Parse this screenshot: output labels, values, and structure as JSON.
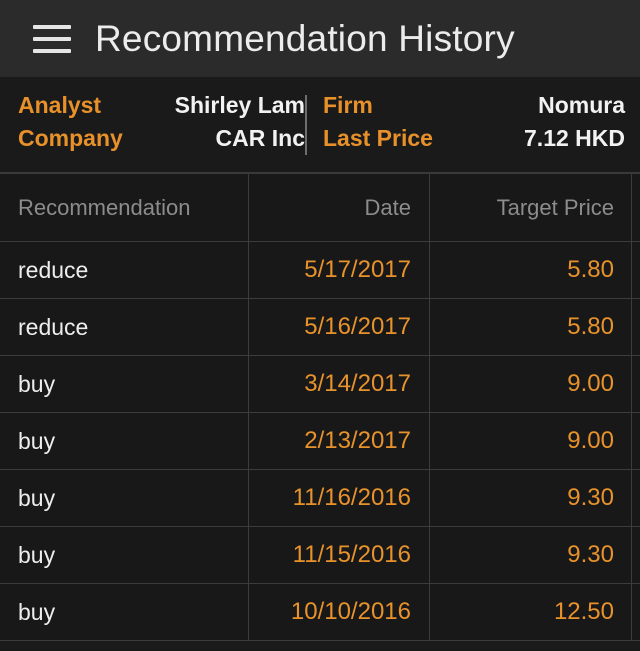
{
  "appbar": {
    "menu_icon": "hamburger-menu-icon",
    "title": "Recommendation History"
  },
  "info": {
    "analyst_label": "Analyst",
    "analyst_value": "Shirley Lam",
    "company_label": "Company",
    "company_value": "CAR Inc",
    "firm_label": "Firm",
    "firm_value": "Nomura",
    "last_price_label": "Last Price",
    "last_price_value": "7.12 HKD"
  },
  "table": {
    "columns": [
      "Recommendation",
      "Date",
      "Target Price"
    ],
    "rows": [
      {
        "recommendation": "reduce",
        "date": "5/17/2017",
        "target_price": "5.80"
      },
      {
        "recommendation": "reduce",
        "date": "5/16/2017",
        "target_price": "5.80"
      },
      {
        "recommendation": "buy",
        "date": "3/14/2017",
        "target_price": "9.00"
      },
      {
        "recommendation": "buy",
        "date": "2/13/2017",
        "target_price": "9.00"
      },
      {
        "recommendation": "buy",
        "date": "11/16/2016",
        "target_price": "9.30"
      },
      {
        "recommendation": "buy",
        "date": "11/15/2016",
        "target_price": "9.30"
      },
      {
        "recommendation": "buy",
        "date": "10/10/2016",
        "target_price": "12.50"
      }
    ]
  },
  "colors": {
    "accent_orange": "#e8912a",
    "value_orange": "#e8922c",
    "appbar_bg": "#2b2b2b",
    "page_bg": "#1a1a1a",
    "table_bg": "#181818",
    "divider": "#3c3c3c",
    "header_text": "#8c8c8c"
  }
}
